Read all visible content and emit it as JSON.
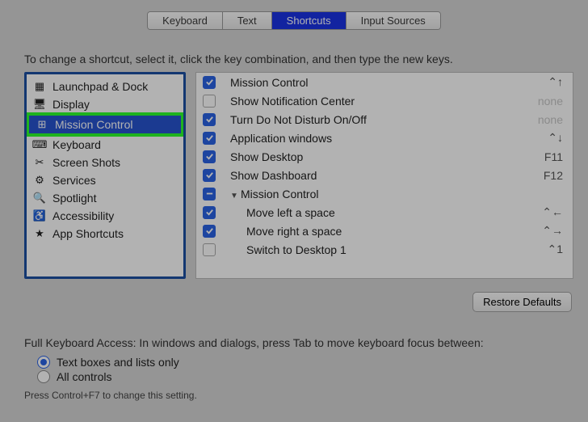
{
  "tabs": [
    "Keyboard",
    "Text",
    "Shortcuts",
    "Input Sources"
  ],
  "active_tab_index": 2,
  "instruction": "To change a shortcut, select it, click the key combination, and then type the new keys.",
  "sidebar": {
    "items": [
      {
        "label": "Launchpad & Dock",
        "icon": "launchpad"
      },
      {
        "label": "Display",
        "icon": "display"
      },
      {
        "label": "Mission Control",
        "icon": "mission-control"
      },
      {
        "label": "Keyboard",
        "icon": "keyboard"
      },
      {
        "label": "Screen Shots",
        "icon": "screenshots"
      },
      {
        "label": "Services",
        "icon": "services"
      },
      {
        "label": "Spotlight",
        "icon": "spotlight"
      },
      {
        "label": "Accessibility",
        "icon": "accessibility"
      },
      {
        "label": "App Shortcuts",
        "icon": "app-shortcuts"
      }
    ],
    "selected_index": 2
  },
  "shortcuts": [
    {
      "checked": true,
      "label": "Mission Control",
      "key": "⌃↑",
      "key_dim": false,
      "disclosure": null,
      "indent": 0
    },
    {
      "checked": false,
      "label": "Show Notification Center",
      "key": "none",
      "key_dim": true,
      "disclosure": null,
      "indent": 0
    },
    {
      "checked": true,
      "label": "Turn Do Not Disturb On/Off",
      "key": "none",
      "key_dim": true,
      "disclosure": null,
      "indent": 0
    },
    {
      "checked": true,
      "label": "Application windows",
      "key": "⌃↓",
      "key_dim": false,
      "disclosure": null,
      "indent": 0
    },
    {
      "checked": true,
      "label": "Show Desktop",
      "key": "F11",
      "key_dim": false,
      "disclosure": null,
      "indent": 0
    },
    {
      "checked": true,
      "label": "Show Dashboard",
      "key": "F12",
      "key_dim": false,
      "disclosure": null,
      "indent": 0
    },
    {
      "checked": "mixed",
      "label": "Mission Control",
      "key": "",
      "key_dim": false,
      "disclosure": "down",
      "indent": 0
    },
    {
      "checked": true,
      "label": "Move left a space",
      "key": "⌃←",
      "key_dim": false,
      "disclosure": null,
      "indent": 1
    },
    {
      "checked": true,
      "label": "Move right a space",
      "key": "⌃→",
      "key_dim": false,
      "disclosure": null,
      "indent": 1
    },
    {
      "checked": false,
      "label": "Switch to Desktop 1",
      "key": "⌃1",
      "key_dim": false,
      "disclosure": null,
      "indent": 1
    }
  ],
  "restore_label": "Restore Defaults",
  "fka": {
    "title": "Full Keyboard Access: In windows and dialogs, press Tab to move keyboard focus between:",
    "options": [
      "Text boxes and lists only",
      "All controls"
    ],
    "selected": 0,
    "footnote": "Press Control+F7 to change this setting."
  },
  "icons": {
    "launchpad": "▦",
    "display": "🖥",
    "mission-control": "⊞",
    "keyboard": "⌨",
    "screenshots": "✂",
    "services": "⚙",
    "spotlight": "🔍",
    "accessibility": "♿",
    "app-shortcuts": "★"
  }
}
